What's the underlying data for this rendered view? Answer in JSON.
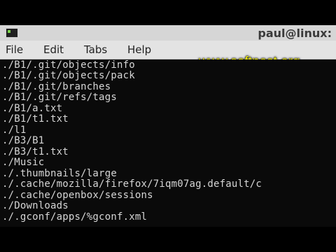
{
  "window": {
    "title": "paul@linux:",
    "watermark": "www.softpost.org"
  },
  "menubar": {
    "items": [
      "File",
      "Edit",
      "Tabs",
      "Help"
    ]
  },
  "terminal": {
    "lines": [
      "./B1/.git/objects/info",
      "./B1/.git/objects/pack",
      "./B1/.git/branches",
      "./B1/.git/refs/tags",
      "./B1/a.txt",
      "./B1/t1.txt",
      "./l1",
      "./B3/B1",
      "./B3/t1.txt",
      "./Music",
      "./.thumbnails/large",
      "./.cache/mozilla/firefox/7iqm07ag.default/c",
      "./.cache/openbox/sessions",
      "./Downloads",
      "./.gconf/apps/%gconf.xml"
    ]
  }
}
